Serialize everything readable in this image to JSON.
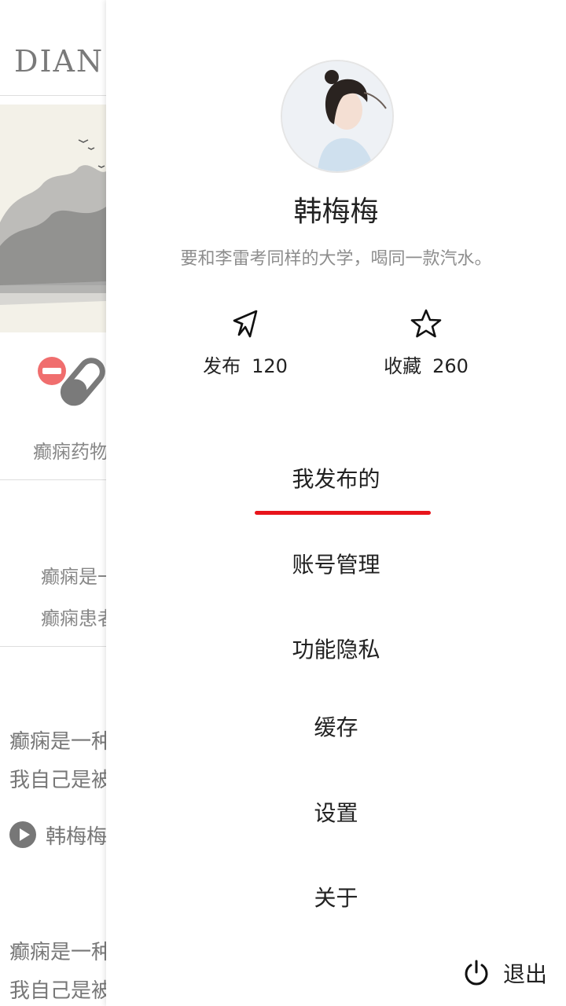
{
  "background": {
    "logo": "DIAN",
    "drug_label": "癫痫药物",
    "card_line1": "癫痫是一",
    "card_line2": "癫痫患者",
    "post1_line1": "癫痫是一种",
    "post1_line2": "我自己是被",
    "post1_author": "韩梅梅",
    "post2_line1": "癫痫是一种",
    "post2_line2": "我自己是被"
  },
  "profile": {
    "name": "韩梅梅",
    "bio": "要和李雷考同样的大学，喝同一款汽水。"
  },
  "stats": [
    {
      "label": "发布",
      "value": "120",
      "icon": "cursor-icon"
    },
    {
      "label": "收藏",
      "value": "260",
      "icon": "star-icon"
    }
  ],
  "menu": [
    {
      "label": "我发布的",
      "active": true
    },
    {
      "label": "账号管理"
    },
    {
      "label": "功能隐私"
    },
    {
      "label": "缓存"
    },
    {
      "label": "设置"
    },
    {
      "label": "关于"
    }
  ],
  "logout": {
    "label": "退出",
    "icon": "power-icon"
  },
  "colors": {
    "accent": "#e8141b",
    "text": "#222222",
    "muted": "#8d8d8d"
  }
}
